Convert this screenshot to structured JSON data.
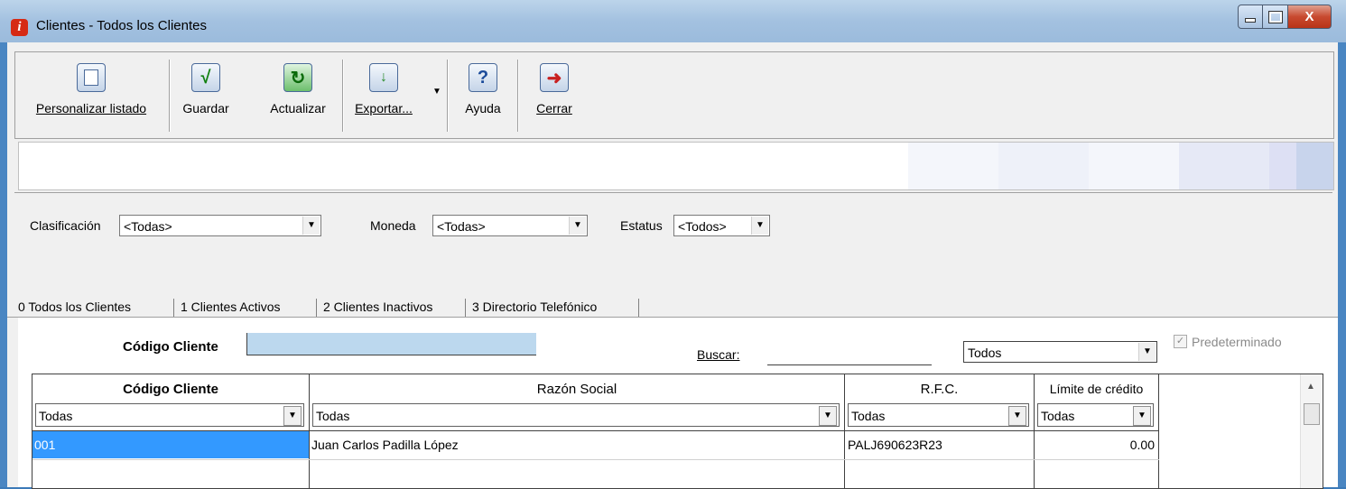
{
  "window": {
    "title": "Clientes - Todos los Clientes",
    "app_icon_glyph": "i",
    "close_glyph": "X"
  },
  "toolbar": {
    "personalizar": "Personalizar listado",
    "guardar": "Guardar",
    "actualizar": "Actualizar",
    "exportar": "Exportar...",
    "ayuda": "Ayuda",
    "cerrar": "Cerrar"
  },
  "filters": {
    "clasificacion_label": "Clasificación",
    "clasificacion_value": "<Todas>",
    "moneda_label": "Moneda",
    "moneda_value": "<Todas>",
    "estatus_label": "Estatus",
    "estatus_value": "<Todos>"
  },
  "tabs": [
    "0 Todos los Clientes",
    "1 Clientes Activos",
    "2 Clientes Inactivos",
    "3 Directorio Telefónico"
  ],
  "search": {
    "codigo_label": "Código Cliente",
    "codigo_value": "",
    "buscar_label": "Buscar:",
    "buscar_value": "",
    "scope_value": "Todos",
    "predeterminado_label": "Predeterminado",
    "predeterminado_checked": true
  },
  "grid": {
    "columns": [
      "Código Cliente",
      "Razón Social",
      "R.F.C.",
      "Límite de crédito"
    ],
    "filters": [
      "Todas",
      "Todas",
      "Todas",
      "Todas"
    ],
    "rows": [
      {
        "codigo": "001",
        "razon": "Juan Carlos Padilla López",
        "rfc": "PALJ690623R23",
        "limite": "0.00"
      }
    ]
  }
}
